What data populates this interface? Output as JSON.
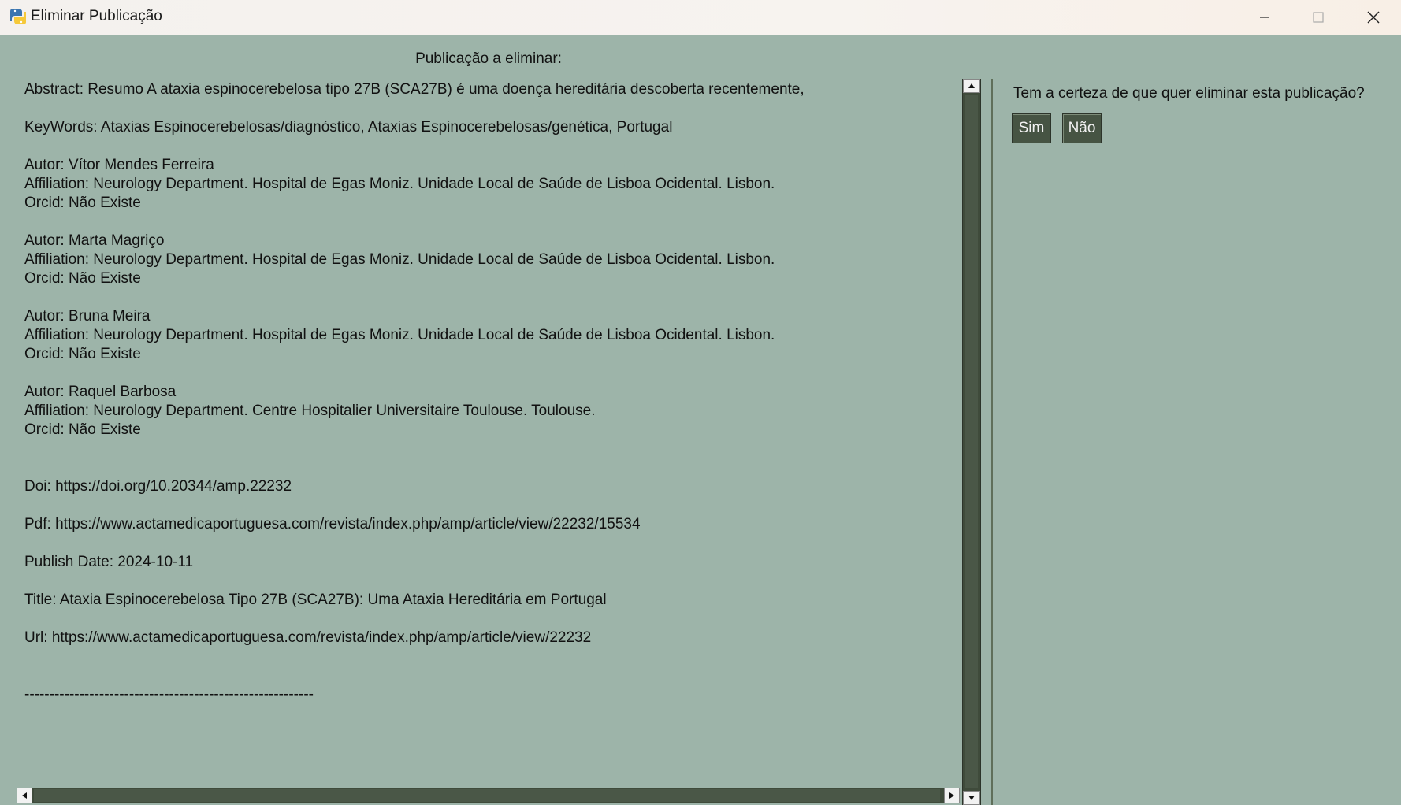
{
  "window": {
    "title": "Eliminar Publicação",
    "controls": {
      "minimize": "minimize-icon",
      "maximize": "maximize-icon",
      "close": "close-icon"
    }
  },
  "publication": {
    "heading": "Publicação a eliminar:",
    "abstract": "Abstract: Resumo A ataxia espinocerebelosa tipo 27B (SCA27B) é uma doença hereditária descoberta recentemente,",
    "keywords": "KeyWords: Ataxias Espinocerebelosas/diagnóstico, Ataxias Espinocerebelosas/genética, Portugal",
    "authors": [
      {
        "autor": "Autor: Vítor Mendes Ferreira",
        "affiliation": "Affiliation: Neurology Department. Hospital de Egas Moniz. Unidade Local de Saúde de Lisboa Ocidental. Lisbon.",
        "orcid": "Orcid: Não Existe"
      },
      {
        "autor": "Autor: Marta Magriço",
        "affiliation": "Affiliation: Neurology Department. Hospital de Egas Moniz. Unidade Local de Saúde de Lisboa Ocidental. Lisbon.",
        "orcid": "Orcid: Não Existe"
      },
      {
        "autor": "Autor: Bruna Meira",
        "affiliation": "Affiliation: Neurology Department. Hospital de Egas Moniz. Unidade Local de Saúde de Lisboa Ocidental. Lisbon.",
        "orcid": "Orcid: Não Existe"
      },
      {
        "autor": "Autor: Raquel Barbosa",
        "affiliation": "Affiliation: Neurology Department. Centre Hospitalier Universitaire Toulouse. Toulouse.",
        "orcid": "Orcid: Não Existe"
      }
    ],
    "doi": "Doi: https://doi.org/10.20344/amp.22232",
    "pdf": "Pdf: https://www.actamedicaportuguesa.com/revista/index.php/amp/article/view/22232/15534",
    "publish_date": "Publish Date: 2024-10-11",
    "title": "Title: Ataxia Espinocerebelosa Tipo 27B (SCA27B): Uma Ataxia Hereditária em Portugal",
    "url": "Url: https://www.actamedicaportuguesa.com/revista/index.php/amp/article/view/22232",
    "separator": "----------------------------------------------------------"
  },
  "confirm": {
    "question": "Tem a certeza de que quer eliminar esta publicação?",
    "yes_label": "Sim",
    "no_label": "Não"
  },
  "colors": {
    "background": "#9db4a9",
    "button": "#465443",
    "scrollbar": "#3f4b3b"
  }
}
